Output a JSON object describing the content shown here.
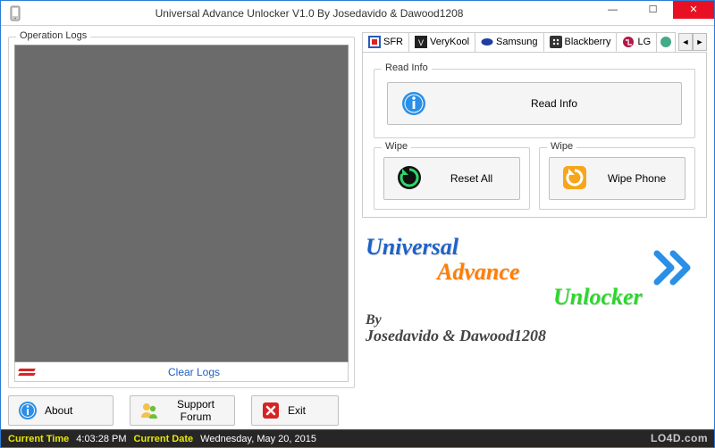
{
  "window": {
    "title": "Universal Advance Unlocker V1.0 By Josedavido & Dawood1208"
  },
  "left": {
    "op_logs_label": "Operation Logs",
    "clear_logs": "Clear Logs"
  },
  "buttons": {
    "about": "About",
    "support": "Support Forum",
    "exit": "Exit"
  },
  "tabs": {
    "sfr": "SFR",
    "verykool": "VeryKool",
    "samsung": "Samsung",
    "blackberry": "Blackberry",
    "lg": "LG"
  },
  "readinfo": {
    "group_label": "Read Info",
    "button": "Read Info"
  },
  "wipe1": {
    "group_label": "Wipe",
    "button": "Reset All"
  },
  "wipe2": {
    "group_label": "Wipe",
    "button": "Wipe Phone"
  },
  "brand": {
    "line1": "Universal",
    "line2": "Advance",
    "line3": "Unlocker",
    "by": "By",
    "authors": "Josedavido & Dawood1208"
  },
  "status": {
    "time_label": "Current Time",
    "time_value": "4:03:28 PM",
    "date_label": "Current Date",
    "date_value": "Wednesday, May 20, 2015"
  },
  "watermark": "LO4D.com"
}
